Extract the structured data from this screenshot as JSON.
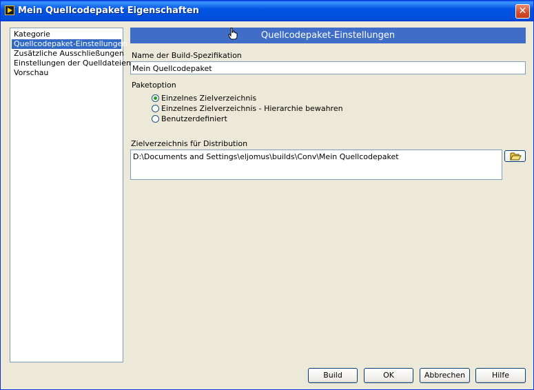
{
  "window": {
    "title": "Mein Quellcodepaket Eigenschaften",
    "close_glyph": "✕"
  },
  "sidebar": {
    "items": [
      {
        "label": "Kategorie"
      },
      {
        "label": "Quellcodepaket-Einstellungen"
      },
      {
        "label": "Zusätzliche Ausschließungen"
      },
      {
        "label": "Einstellungen der Quelldateien"
      },
      {
        "label": "Vorschau"
      }
    ],
    "selected_index": 1
  },
  "main": {
    "header": "Quellcodepaket-Einstellungen",
    "build_name_label": "Name der Build-Spezifikation",
    "build_name_value": "Mein Quellcodepaket",
    "package_option_label": "Paketoption",
    "options": [
      {
        "label": "Einzelnes Zielverzeichnis",
        "checked": true
      },
      {
        "label": "Einzelnes Zielverzeichnis - Hierarchie bewahren",
        "checked": false
      },
      {
        "label": "Benutzerdefiniert",
        "checked": false
      }
    ],
    "destination_label": "Zielverzeichnis für Distribution",
    "destination_value": "D:\\Documents and Settings\\eljomus\\builds\\Conv\\Mein Quellcodepaket"
  },
  "footer": {
    "build": "Build",
    "ok": "OK",
    "cancel": "Abbrechen",
    "help": "Hilfe"
  },
  "icons": {
    "app": "labview-icon",
    "folder": "folder-open-icon",
    "cursor": "hand-pointer-icon"
  },
  "colors": {
    "title_bar": "#0054E3",
    "header_bar": "#3F6DC7",
    "selection": "#316AC5",
    "radio_dot": "#21A121"
  }
}
